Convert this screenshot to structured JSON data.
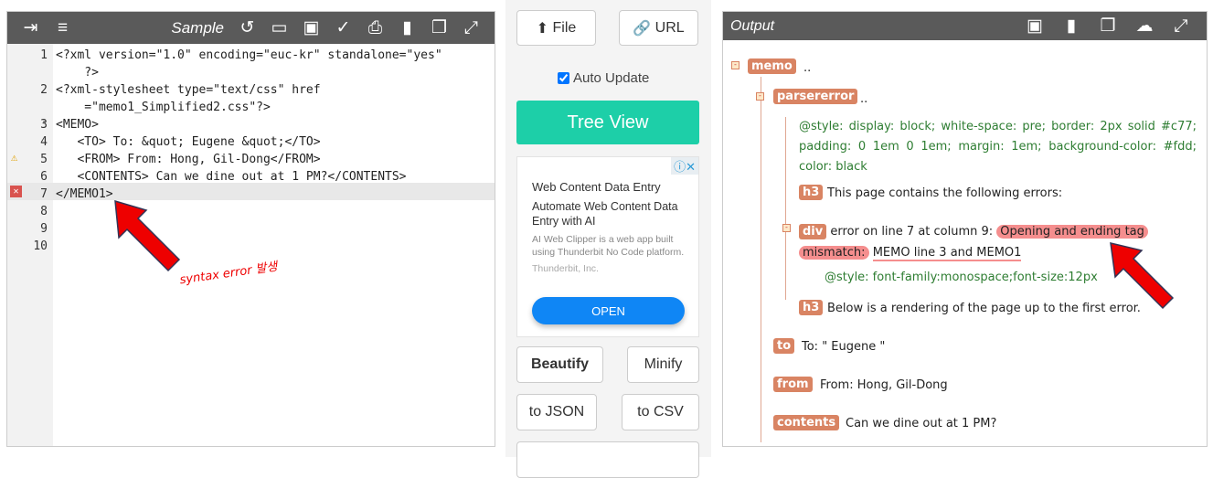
{
  "editor": {
    "title": "Sample",
    "icons": [
      "indent-icon",
      "format-icon",
      "history-icon",
      "folder-icon",
      "save-icon",
      "check-icon",
      "print-icon",
      "trash-icon",
      "copy-icon",
      "expand-icon"
    ],
    "lines": [
      {
        "n": "1",
        "text": "<?xml version=\"1.0\" encoding=\"euc-kr\" standalone=\"yes\""
      },
      {
        "n": "",
        "text": "    ?>"
      },
      {
        "n": "2",
        "text": "<?xml-stylesheet type=\"text/css\" href"
      },
      {
        "n": "",
        "text": "    =\"memo1_Simplified2.css\"?>"
      },
      {
        "n": "3",
        "text": "<MEMO>"
      },
      {
        "n": "4",
        "text": "   <TO> To: &quot; Eugene &quot;</TO>"
      },
      {
        "n": "5",
        "text": "   <FROM> From: Hong, Gil-Dong</FROM>"
      },
      {
        "n": "6",
        "text": "   <CONTENTS> Can we dine out at 1 PM?</CONTENTS>"
      },
      {
        "n": "7",
        "text": "</MEMO1>"
      },
      {
        "n": "8",
        "text": ""
      },
      {
        "n": "9",
        "text": ""
      },
      {
        "n": "10",
        "text": ""
      }
    ],
    "annotation": "syntax error 발생"
  },
  "middle": {
    "file": "File",
    "url": "URL",
    "auto_update": "Auto Update",
    "tree_view": "Tree View",
    "beautify": "Beautify",
    "minify": "Minify",
    "to_json": "to JSON",
    "to_csv": "to CSV",
    "ad": {
      "title": "Web Content Data Entry",
      "headline": "Automate Web Content Data Entry with AI",
      "body": "AI Web Clipper is a web app built using Thunderbit No Code platform.",
      "advertiser": "Thunderbit, Inc.",
      "cta": "OPEN"
    }
  },
  "output": {
    "title": "Output",
    "memo": "memo",
    "dots": "..",
    "parsererror": "parsererror",
    "style1": "@style: display: block; white-space: pre; border: 2px solid #c77; padding: 0 1em 0 1em; margin: 1em; background-color: #fdd; color: black",
    "h3": "h3",
    "h3_text1": "This page contains the following errors:",
    "div": "div",
    "err_prefix": "error on line 7 at column 9: ",
    "err_mark1": "Opening and ending tag",
    "err_mark2": "mismatch:",
    "err_rest": "MEMO line 3 and MEMO1",
    "style2": "@style:  font-family:monospace;font-size:12px",
    "h3_text2": "Below is a rendering of the page up to the first error.",
    "to": "to",
    "to_text": "To: \" Eugene \"",
    "from": "from",
    "from_text": "From: Hong, Gil-Dong",
    "contents": "contents",
    "contents_text": "Can we dine out at 1 PM?"
  }
}
